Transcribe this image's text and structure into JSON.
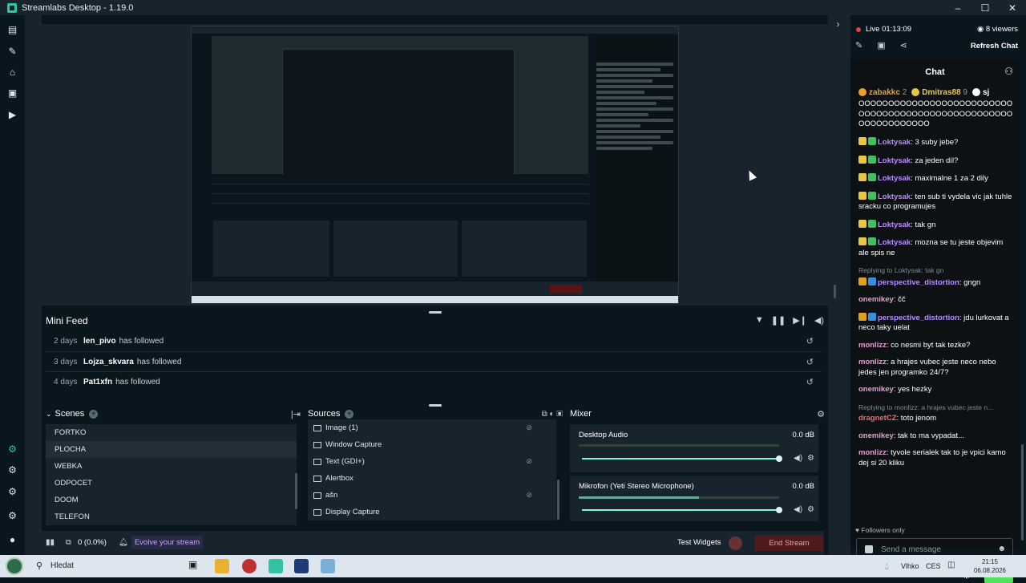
{
  "window": {
    "title": "Streamlabs Desktop - 1.19.0",
    "controls": {
      "minimize": "–",
      "maximize": "☐",
      "close": "✕"
    }
  },
  "leftnav": {
    "top_icons": [
      "dashboard-icon",
      "themes-icon",
      "store-icon",
      "library-icon",
      "play-icon"
    ],
    "bottom_icons": [
      "studio-mode-icon",
      "layout-icon",
      "apps-icon",
      "settings-icon",
      "user-icon"
    ]
  },
  "minifeed": {
    "title": "Mini Feed",
    "events": [
      {
        "time": "2 days",
        "name": "len_pivo",
        "action": "has followed"
      },
      {
        "time": "3 days",
        "name": "Lojza_skvara",
        "action": "has followed"
      },
      {
        "time": "4 days",
        "name": "Pat1xfn",
        "action": "has followed"
      }
    ]
  },
  "scenes": {
    "title": "Scenes",
    "items": [
      {
        "label": "FORTKO",
        "active": false
      },
      {
        "label": "PLOCHA",
        "active": true
      },
      {
        "label": "WEBKA",
        "active": false
      },
      {
        "label": "ODPOCET",
        "active": false
      },
      {
        "label": "DOOM",
        "active": false
      },
      {
        "label": "TELEFON",
        "active": false
      }
    ]
  },
  "sources": {
    "title": "Sources",
    "items": [
      {
        "label": "Image (1)",
        "hidden": true
      },
      {
        "label": "Window Capture",
        "hidden": false
      },
      {
        "label": "Text (GDI+)",
        "hidden": true
      },
      {
        "label": "Alertbox",
        "hidden": false
      },
      {
        "label": "ašn",
        "hidden": true
      },
      {
        "label": "Display Capture",
        "hidden": false
      }
    ]
  },
  "mixer": {
    "title": "Mixer",
    "channels": [
      {
        "name": "Desktop Audio",
        "db": "0.0 dB",
        "volume": 1.0,
        "level": 0.0
      },
      {
        "name": "Mikrofon (Yeti Stereo Microphone)",
        "db": "0.0 dB",
        "volume": 1.0,
        "level": 0.6
      }
    ]
  },
  "bottombar": {
    "cpu": "0 (0.0%)",
    "evolve": "Evolve your stream",
    "test_widgets": "Test Widgets",
    "end_stream": "End Stream"
  },
  "live": {
    "status": "Live 01:13:09",
    "viewers": "8 viewers",
    "refresh": "Refresh Chat"
  },
  "chat": {
    "title": "Chat",
    "top_badges": [
      {
        "name": "zabakkc",
        "count": "2",
        "color": "#e8a030"
      },
      {
        "name": "Dmitras88",
        "count": "9",
        "color": "#e8c840"
      },
      {
        "name": "sj",
        "count": "",
        "color": "#ffffff"
      }
    ],
    "spam_text": "OOOOOOOOOOOOOOOOOOOOOOOOOOOOOOOOOOOOOOOOOOOOOOOOOOOOOOOOOOOOOOOO",
    "messages": [
      {
        "badges": [
          "b-sub",
          "b-green"
        ],
        "user": "Loktysak",
        "color": "u-purple",
        "text": "3 suby jebe?",
        "reply": ""
      },
      {
        "badges": [
          "b-sub",
          "b-green"
        ],
        "user": "Loktysak",
        "color": "u-purple",
        "text": "za jeden díl?",
        "reply": ""
      },
      {
        "badges": [
          "b-sub",
          "b-green"
        ],
        "user": "Loktysak",
        "color": "u-purple",
        "text": "maximalne 1 za 2 dily",
        "reply": ""
      },
      {
        "badges": [
          "b-sub",
          "b-green"
        ],
        "user": "Loktysak",
        "color": "u-purple",
        "text": "ten sub ti vydela vic jak tuhle sracku co programujes",
        "reply": ""
      },
      {
        "badges": [
          "b-sub",
          "b-green"
        ],
        "user": "Loktysak",
        "color": "u-purple",
        "text": "tak gn",
        "reply": ""
      },
      {
        "badges": [
          "b-sub",
          "b-green"
        ],
        "user": "Loktysak",
        "color": "u-purple",
        "text": "mozna se tu jeste objevim ale spis ne",
        "reply": ""
      },
      {
        "badges": [
          "b-crown",
          "b-verified"
        ],
        "user": "perspective_distortion",
        "color": "u-purple",
        "text": "gngn",
        "reply": "Replying to Loktysak: tak gn"
      },
      {
        "badges": [],
        "user": "onemikey",
        "color": "u-pink",
        "text": "čč",
        "reply": ""
      },
      {
        "badges": [
          "b-crown",
          "b-verified"
        ],
        "user": "perspective_distortion",
        "color": "u-purple",
        "text": "jdu lurkovat a neco taky uelat",
        "reply": ""
      },
      {
        "badges": [],
        "user": "monlizz",
        "color": "u-pink",
        "text": "co nesmi byt tak tezke?",
        "reply": ""
      },
      {
        "badges": [],
        "user": "monlizz",
        "color": "u-pink",
        "text": "a hrajes vubec jeste neco nebo jedes jen programko 24/7?",
        "reply": ""
      },
      {
        "badges": [],
        "user": "onemikey",
        "color": "u-pink",
        "text": "yes hezky",
        "reply": ""
      },
      {
        "badges": [],
        "user": "dragnetCZ",
        "color": "u-red",
        "text": "toto jenom",
        "reply": "Replying to monlizz: a hrajes vubec jeste n..."
      },
      {
        "badges": [],
        "user": "onemikey",
        "color": "u-pink",
        "text": "tak to ma vypadat...",
        "reply": ""
      },
      {
        "badges": [],
        "user": "monlizz",
        "color": "u-pink",
        "text": "tyvole serialek tak to je vpici kamo dej si 20 kliku",
        "reply": ""
      }
    ],
    "followers_only": "Followers only",
    "send_placeholder": "Send a message",
    "chat_button": "Chat"
  },
  "taskbar": {
    "search": "Hledat",
    "weather": "Vlhko",
    "lang": "CES",
    "time": "21:15",
    "date": "06.08.2026"
  }
}
